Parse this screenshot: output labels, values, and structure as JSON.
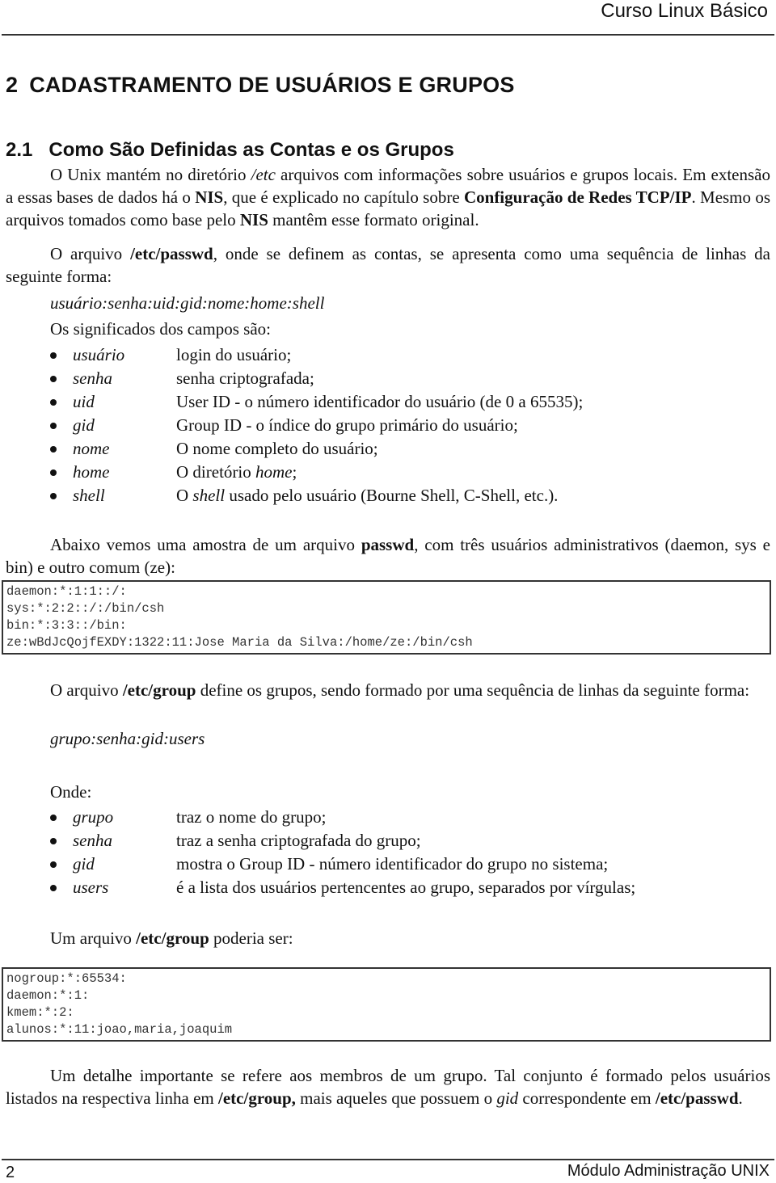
{
  "header": {
    "title": "Curso Linux Básico"
  },
  "chapter": {
    "number": "2",
    "title": "CADASTRAMENTO DE USUÁRIOS E GRUPOS"
  },
  "section": {
    "number": "2.1",
    "title": "Como São Definidas as Contas e os Grupos"
  },
  "intro": {
    "p1_a": "O Unix mantém no diretório ",
    "p1_etc": "/etc",
    "p1_b": " arquivos com informações sobre usuários e grupos locais. Em extensão a essas bases de dados há o ",
    "p1_nis": "NIS",
    "p1_c": ", que é explicado no capítulo sobre ",
    "p1_conf": "Configuração de Redes TCP/IP",
    "p1_d": ". Mesmo os arquivos tomados como base pelo ",
    "p1_nis2": "NIS",
    "p1_e": " mantêm esse formato original."
  },
  "passwd_intro": {
    "a": "O arquivo ",
    "file": "/etc/passwd",
    "b": ", onde se definem as contas, se apresenta como uma sequência de linhas da seguinte forma:",
    "format": "usuário:senha:uid:gid:nome:home:shell",
    "fields_label": "Os significados dos campos são:"
  },
  "passwd_fields": [
    {
      "term": "usuário",
      "desc": "login do usuário;"
    },
    {
      "term": "senha",
      "desc": "senha criptografada;"
    },
    {
      "term": "uid",
      "desc": "User ID - o número identificador do usuário (de 0 a 65535);"
    },
    {
      "term": "gid",
      "desc": "Group ID - o índice do grupo primário do usuário;"
    },
    {
      "term": "nome",
      "desc": "O nome completo do usuário;"
    },
    {
      "term": "home",
      "desc_a": "O diretório ",
      "desc_i": "home",
      "desc_b": ";"
    },
    {
      "term": "shell",
      "desc_a": "O ",
      "desc_i": "shell",
      "desc_b": " usado pelo usuário (Bourne Shell, C-Shell, etc.)."
    }
  ],
  "passwd_sample": {
    "a": "Abaixo vemos uma amostra de um arquivo ",
    "file": "passwd",
    "b": ", com três usuários administrativos (daemon, sys e bin) e outro comum (ze):",
    "lines": [
      "daemon:*:1:1::/:",
      "sys:*:2:2::/:/bin/csh",
      "bin:*:3:3::/bin:",
      "ze:wBdJcQojfEXDY:1322:11:Jose Maria da Silva:/home/ze:/bin/csh"
    ]
  },
  "group_intro": {
    "a": "O arquivo ",
    "file": "/etc/group",
    "b": " define os grupos, sendo formado por uma sequência de linhas da seguinte forma:",
    "format": "grupo:senha:gid:users",
    "where_label": "Onde:"
  },
  "group_fields": [
    {
      "term": "grupo",
      "desc": "traz o nome do grupo;"
    },
    {
      "term": "senha",
      "desc": "traz a senha criptografada do grupo;"
    },
    {
      "term": "gid",
      "desc": "mostra o Group ID - número identificador do grupo no sistema;"
    },
    {
      "term": "users",
      "desc": "é a lista dos usuários pertencentes ao grupo, separados por vírgulas;"
    }
  ],
  "group_sample": {
    "a": "Um arquivo ",
    "file": "/etc/group",
    "b": " poderia ser:",
    "lines": [
      "nogroup:*:65534:",
      "daemon:*:1:",
      "kmem:*:2:",
      "alunos:*:11:joao,maria,joaquim"
    ]
  },
  "closing": {
    "a": "Um detalhe importante se refere aos membros de um grupo. Tal conjunto é formado pelos usuários listados na respectiva linha em ",
    "file1": "/etc/group,",
    "b": " mais aqueles que possuem o ",
    "gid": "gid",
    "c": " correspondente em ",
    "file2": "/etc/passwd",
    "d": "."
  },
  "footer": {
    "page": "2",
    "title": "Módulo Administração UNIX"
  }
}
